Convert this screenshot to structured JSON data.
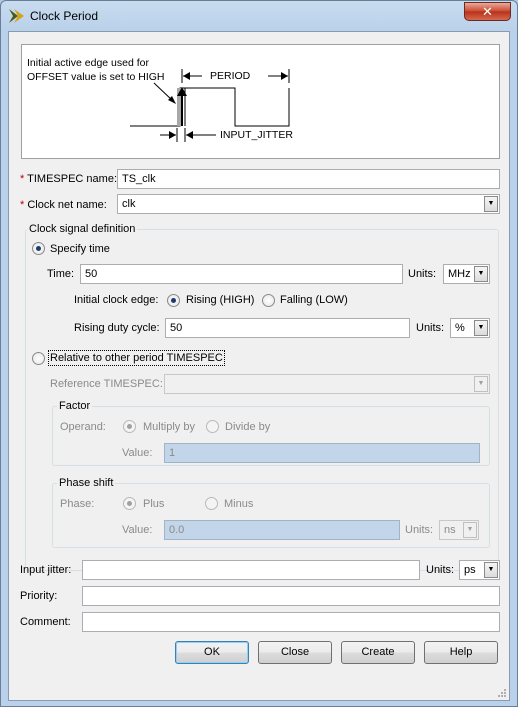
{
  "window": {
    "title": "Clock Period",
    "close_glyph": "✕"
  },
  "diagram": {
    "note": "Initial active edge used for OFFSET value is set to HIGH",
    "period_label": "PERIOD",
    "jitter_label": "INPUT_JITTER"
  },
  "timespec_name": {
    "required_mark": "*",
    "label": "TIMESPEC name:",
    "value": "TS_clk"
  },
  "clock_net_name": {
    "required_mark": "*",
    "label": "Clock net name:",
    "value": "clk"
  },
  "clock_signal_definition": {
    "title": "Clock signal definition",
    "specify_time": {
      "label": "Specify time",
      "selected": true,
      "time_label": "Time:",
      "time_value": "50",
      "units_label": "Units:",
      "units_value": "MHz",
      "initial_edge_label": "Initial clock edge:",
      "rising_label": "Rising (HIGH)",
      "falling_label": "Falling (LOW)",
      "duty_label": "Rising duty cycle:",
      "duty_value": "50",
      "duty_units_label": "Units:",
      "duty_units_value": "%"
    },
    "relative": {
      "label": "Relative to other period TIMESPEC",
      "selected": false,
      "reference_label": "Reference TIMESPEC:",
      "reference_value": "",
      "factor": {
        "title": "Factor",
        "operand_label": "Operand:",
        "multiply_label": "Multiply by",
        "divide_label": "Divide by",
        "value_label": "Value:",
        "value": "1"
      },
      "phase_shift": {
        "title": "Phase shift",
        "phase_label": "Phase:",
        "plus_label": "Plus",
        "minus_label": "Minus",
        "value_label": "Value:",
        "value": "0.0",
        "units_label": "Units:",
        "units_value": "ns"
      }
    }
  },
  "input_jitter": {
    "label": "Input jitter:",
    "value": "",
    "units_label": "Units:",
    "units_value": "ps"
  },
  "priority": {
    "label": "Priority:",
    "value": ""
  },
  "comment": {
    "label": "Comment:",
    "value": ""
  },
  "buttons": {
    "ok": "OK",
    "close": "Close",
    "create": "Create",
    "help": "Help"
  },
  "icons": {
    "app": "xilinx-chevron-icon",
    "dropdown": "chevron-down-icon"
  },
  "colors": {
    "accent": "#3c7fb1",
    "required": "#c00000",
    "disabled_field": "#c3d5e8",
    "title_bar": "#b9d1ea"
  }
}
